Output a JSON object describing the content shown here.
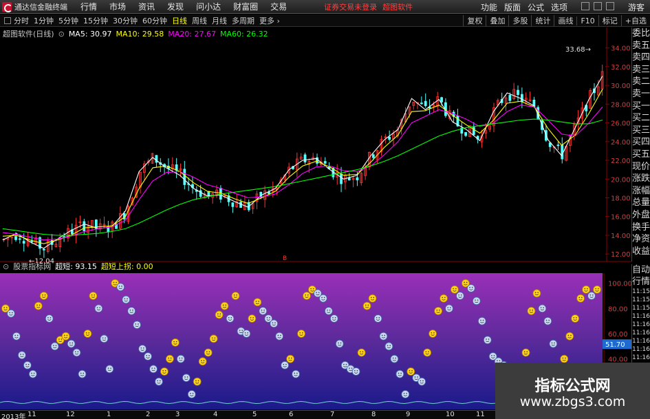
{
  "menubar": {
    "app_title": "通达信金融终端",
    "menus": [
      "行情",
      "市场",
      "资讯",
      "发现",
      "问小达",
      "财富圈",
      "交易"
    ],
    "notice": "证券交易未登录",
    "notice2": "超图软件",
    "right_menus": [
      "功能",
      "版面",
      "公式",
      "选项"
    ],
    "guest": "游客"
  },
  "toolbar": {
    "periods": [
      "分时",
      "1分钟",
      "5分钟",
      "15分钟",
      "30分钟",
      "60分钟",
      "日线",
      "周线",
      "月线",
      "多周期",
      "更多"
    ],
    "active_period": "日线",
    "tools": [
      "复权",
      "叠加",
      "多股",
      "统计",
      "画线",
      "F10",
      "标记",
      "+自选"
    ]
  },
  "main_chart": {
    "name": "超图软件(日线)",
    "ma": [
      {
        "label": "MA5: 30.97",
        "color": "#ffffff"
      },
      {
        "label": "MA10: 29.58",
        "color": "#ffff00"
      },
      {
        "label": "MA20: 27.67",
        "color": "#ff00ff"
      },
      {
        "label": "MA60: 26.32",
        "color": "#00ff00"
      }
    ],
    "price_ticks": [
      "34.00",
      "32.00",
      "30.00",
      "28.00",
      "26.00",
      "24.00",
      "22.00",
      "20.00",
      "18.00",
      "16.00",
      "14.00",
      "12.00"
    ],
    "low_label": "12.04",
    "high_label": "33.68",
    "marker": "B"
  },
  "indicator": {
    "name": "股票指标网",
    "line1": "超短: 93.15",
    "line2": "超短上拐: 0.00",
    "ticks": [
      "100.00",
      "80.00",
      "60.00",
      "40.00"
    ],
    "current": "51.70"
  },
  "quote_panel": {
    "labels": [
      "委比",
      "卖五",
      "卖四",
      "卖三",
      "卖二",
      "卖一",
      "买一",
      "买二",
      "买三",
      "买四",
      "买五",
      "现价",
      "涨跌",
      "涨幅",
      "总量",
      "外盘",
      "换手",
      "净资",
      "收益"
    ],
    "labels2": [
      "自动",
      "行情"
    ],
    "times": [
      "11:15",
      "11:15",
      "11:15",
      "11:16",
      "11:16",
      "11:16",
      "11:16",
      "11:16",
      "11:16"
    ]
  },
  "date_axis": [
    "2013年",
    "11",
    "12",
    "1",
    "2",
    "3",
    "4",
    "5",
    "6",
    "7",
    "8",
    "9",
    "10",
    "11"
  ],
  "watermark": {
    "line1": "指标公式网",
    "line2": "www.zbgs3.com"
  },
  "chart_data": {
    "type": "line",
    "title": "超图软件(日线)",
    "ylim": [
      11.5,
      35
    ],
    "series": [
      {
        "name": "MA5",
        "values": [
          13.5,
          14.2,
          13.3,
          12.6,
          13.6,
          14.5,
          15.2,
          14.7,
          14.9,
          16.6,
          20.8,
          22.3,
          21.2,
          20.4,
          19.0,
          18.2,
          18.3,
          17.6,
          17.0,
          18.3,
          19.0,
          21.0,
          22.0,
          22.2,
          21.0,
          20.0,
          20.4,
          22.5,
          24.2,
          25.3,
          28.6,
          27.4,
          28.5,
          26.1,
          25.3,
          24.1,
          27.2,
          29.2,
          28.6,
          27.8,
          24.2,
          22.5,
          25.5,
          28.5,
          31.0
        ]
      },
      {
        "name": "MA10",
        "values": [
          13.9,
          14.0,
          13.5,
          13.1,
          13.5,
          14.0,
          14.8,
          14.9,
          15.0,
          16.0,
          19.0,
          21.2,
          21.4,
          20.8,
          19.6,
          18.7,
          18.5,
          17.9,
          17.4,
          18.0,
          18.7,
          20.2,
          21.4,
          21.9,
          21.3,
          20.4,
          20.5,
          21.8,
          23.4,
          24.7,
          27.2,
          27.3,
          27.9,
          26.8,
          25.8,
          24.9,
          26.3,
          28.1,
          28.3,
          27.7,
          25.4,
          23.6,
          24.7,
          27.0,
          29.6
        ]
      },
      {
        "name": "MA20",
        "values": [
          14.3,
          14.1,
          13.8,
          13.5,
          13.6,
          13.9,
          14.4,
          14.7,
          14.9,
          15.6,
          17.8,
          19.8,
          20.7,
          20.8,
          20.2,
          19.4,
          19.0,
          18.5,
          18.0,
          18.1,
          18.4,
          19.4,
          20.6,
          21.3,
          21.4,
          20.9,
          20.8,
          21.4,
          22.6,
          24.0,
          26.0,
          26.7,
          27.4,
          27.0,
          26.4,
          25.6,
          26.0,
          27.2,
          27.9,
          27.7,
          26.3,
          24.8,
          24.6,
          26.0,
          27.7
        ]
      },
      {
        "name": "MA60",
        "values": [
          14.7,
          14.5,
          14.3,
          14.1,
          14.0,
          14.0,
          14.1,
          14.2,
          14.4,
          14.7,
          15.3,
          16.0,
          16.7,
          17.3,
          17.8,
          18.1,
          18.4,
          18.6,
          18.8,
          19.0,
          19.2,
          19.5,
          19.8,
          20.1,
          20.4,
          20.7,
          21.0,
          21.4,
          21.9,
          22.5,
          23.2,
          23.9,
          24.6,
          25.1,
          25.5,
          25.7,
          25.9,
          26.1,
          26.3,
          26.4,
          26.3,
          26.1,
          25.9,
          25.9,
          26.3
        ]
      },
      {
        "name": "超短",
        "values": [
          80,
          76,
          58,
          43,
          35,
          28,
          82,
          90,
          72,
          50,
          55,
          58,
          52,
          45,
          28,
          60,
          90,
          80,
          56,
          32,
          100,
          97,
          87,
          78,
          67,
          48,
          42,
          32,
          22,
          30,
          40,
          53,
          40,
          25,
          12,
          22,
          38,
          45,
          56,
          75,
          82,
          72,
          90,
          62,
          60,
          72,
          85,
          78,
          72,
          68,
          58,
          35,
          40,
          28,
          60,
          90,
          95,
          92,
          88,
          78,
          72,
          52,
          35,
          32,
          30,
          45,
          82,
          88,
          72,
          58,
          50,
          40,
          28,
          12,
          30,
          25,
          22,
          45,
          60,
          78,
          88,
          80,
          95,
          90,
          100,
          96,
          86,
          70,
          55,
          42,
          38,
          35,
          30,
          28,
          25,
          45,
          78,
          92,
          80,
          70,
          52,
          20,
          40,
          58,
          72,
          88,
          95,
          90,
          95
        ]
      }
    ]
  }
}
